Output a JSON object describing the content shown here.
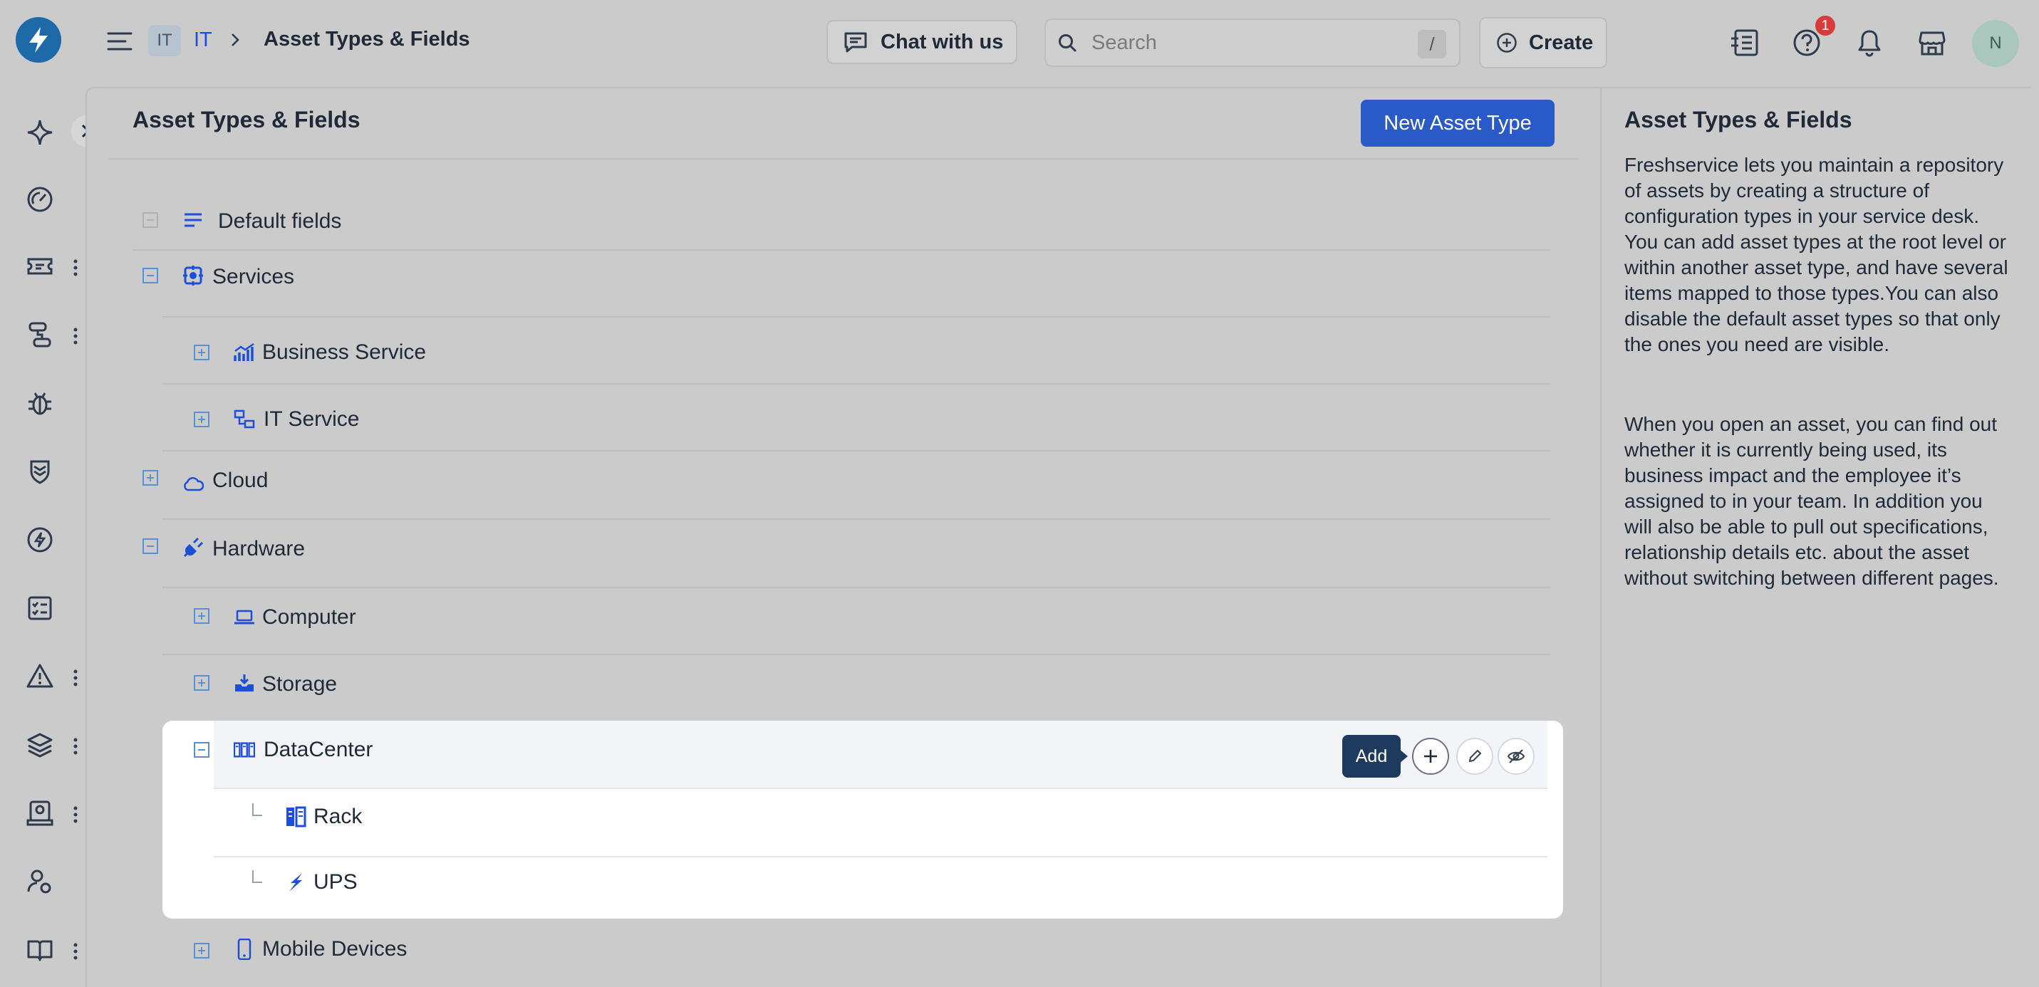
{
  "header": {
    "workspace_badge": "IT",
    "workspace_name": "IT",
    "breadcrumb_title": "Asset Types & Fields",
    "chat_label": "Chat with us",
    "search_placeholder": "Search",
    "search_shortcut": "/",
    "create_label": "Create",
    "notification_count": "1",
    "avatar_initial": "N"
  },
  "main": {
    "title": "Asset Types & Fields",
    "new_button": "New Asset Type",
    "rows": {
      "default_fields": "Default fields",
      "services": "Services",
      "business_service": "Business Service",
      "it_service": "IT Service",
      "cloud": "Cloud",
      "hardware": "Hardware",
      "computer": "Computer",
      "storage": "Storage",
      "datacenter": "DataCenter",
      "rack": "Rack",
      "ups": "UPS",
      "mobile_devices": "Mobile Devices"
    },
    "tooltip": "Add"
  },
  "side": {
    "title": "Asset Types & Fields",
    "paragraph1": "Freshservice lets you maintain a repository of assets by creating a structure of configuration types in your service desk. You can add asset types at the root level or within another asset type, and have several items mapped to those types.You can also disable the default asset types so that only the ones you need are visible.",
    "paragraph2": "When you open an asset, you can find out whether it is currently being used, its business impact and the employee it’s assigned to in your team. In addition you will also be able to pull out specifications, relationship details etc. about the asset without switching between different pages."
  },
  "colors": {
    "accent": "#2a5ac8",
    "icon_blue": "#1d4ed8",
    "tooltip_bg": "#1e3a5f",
    "badge_red": "#d93a3a"
  }
}
